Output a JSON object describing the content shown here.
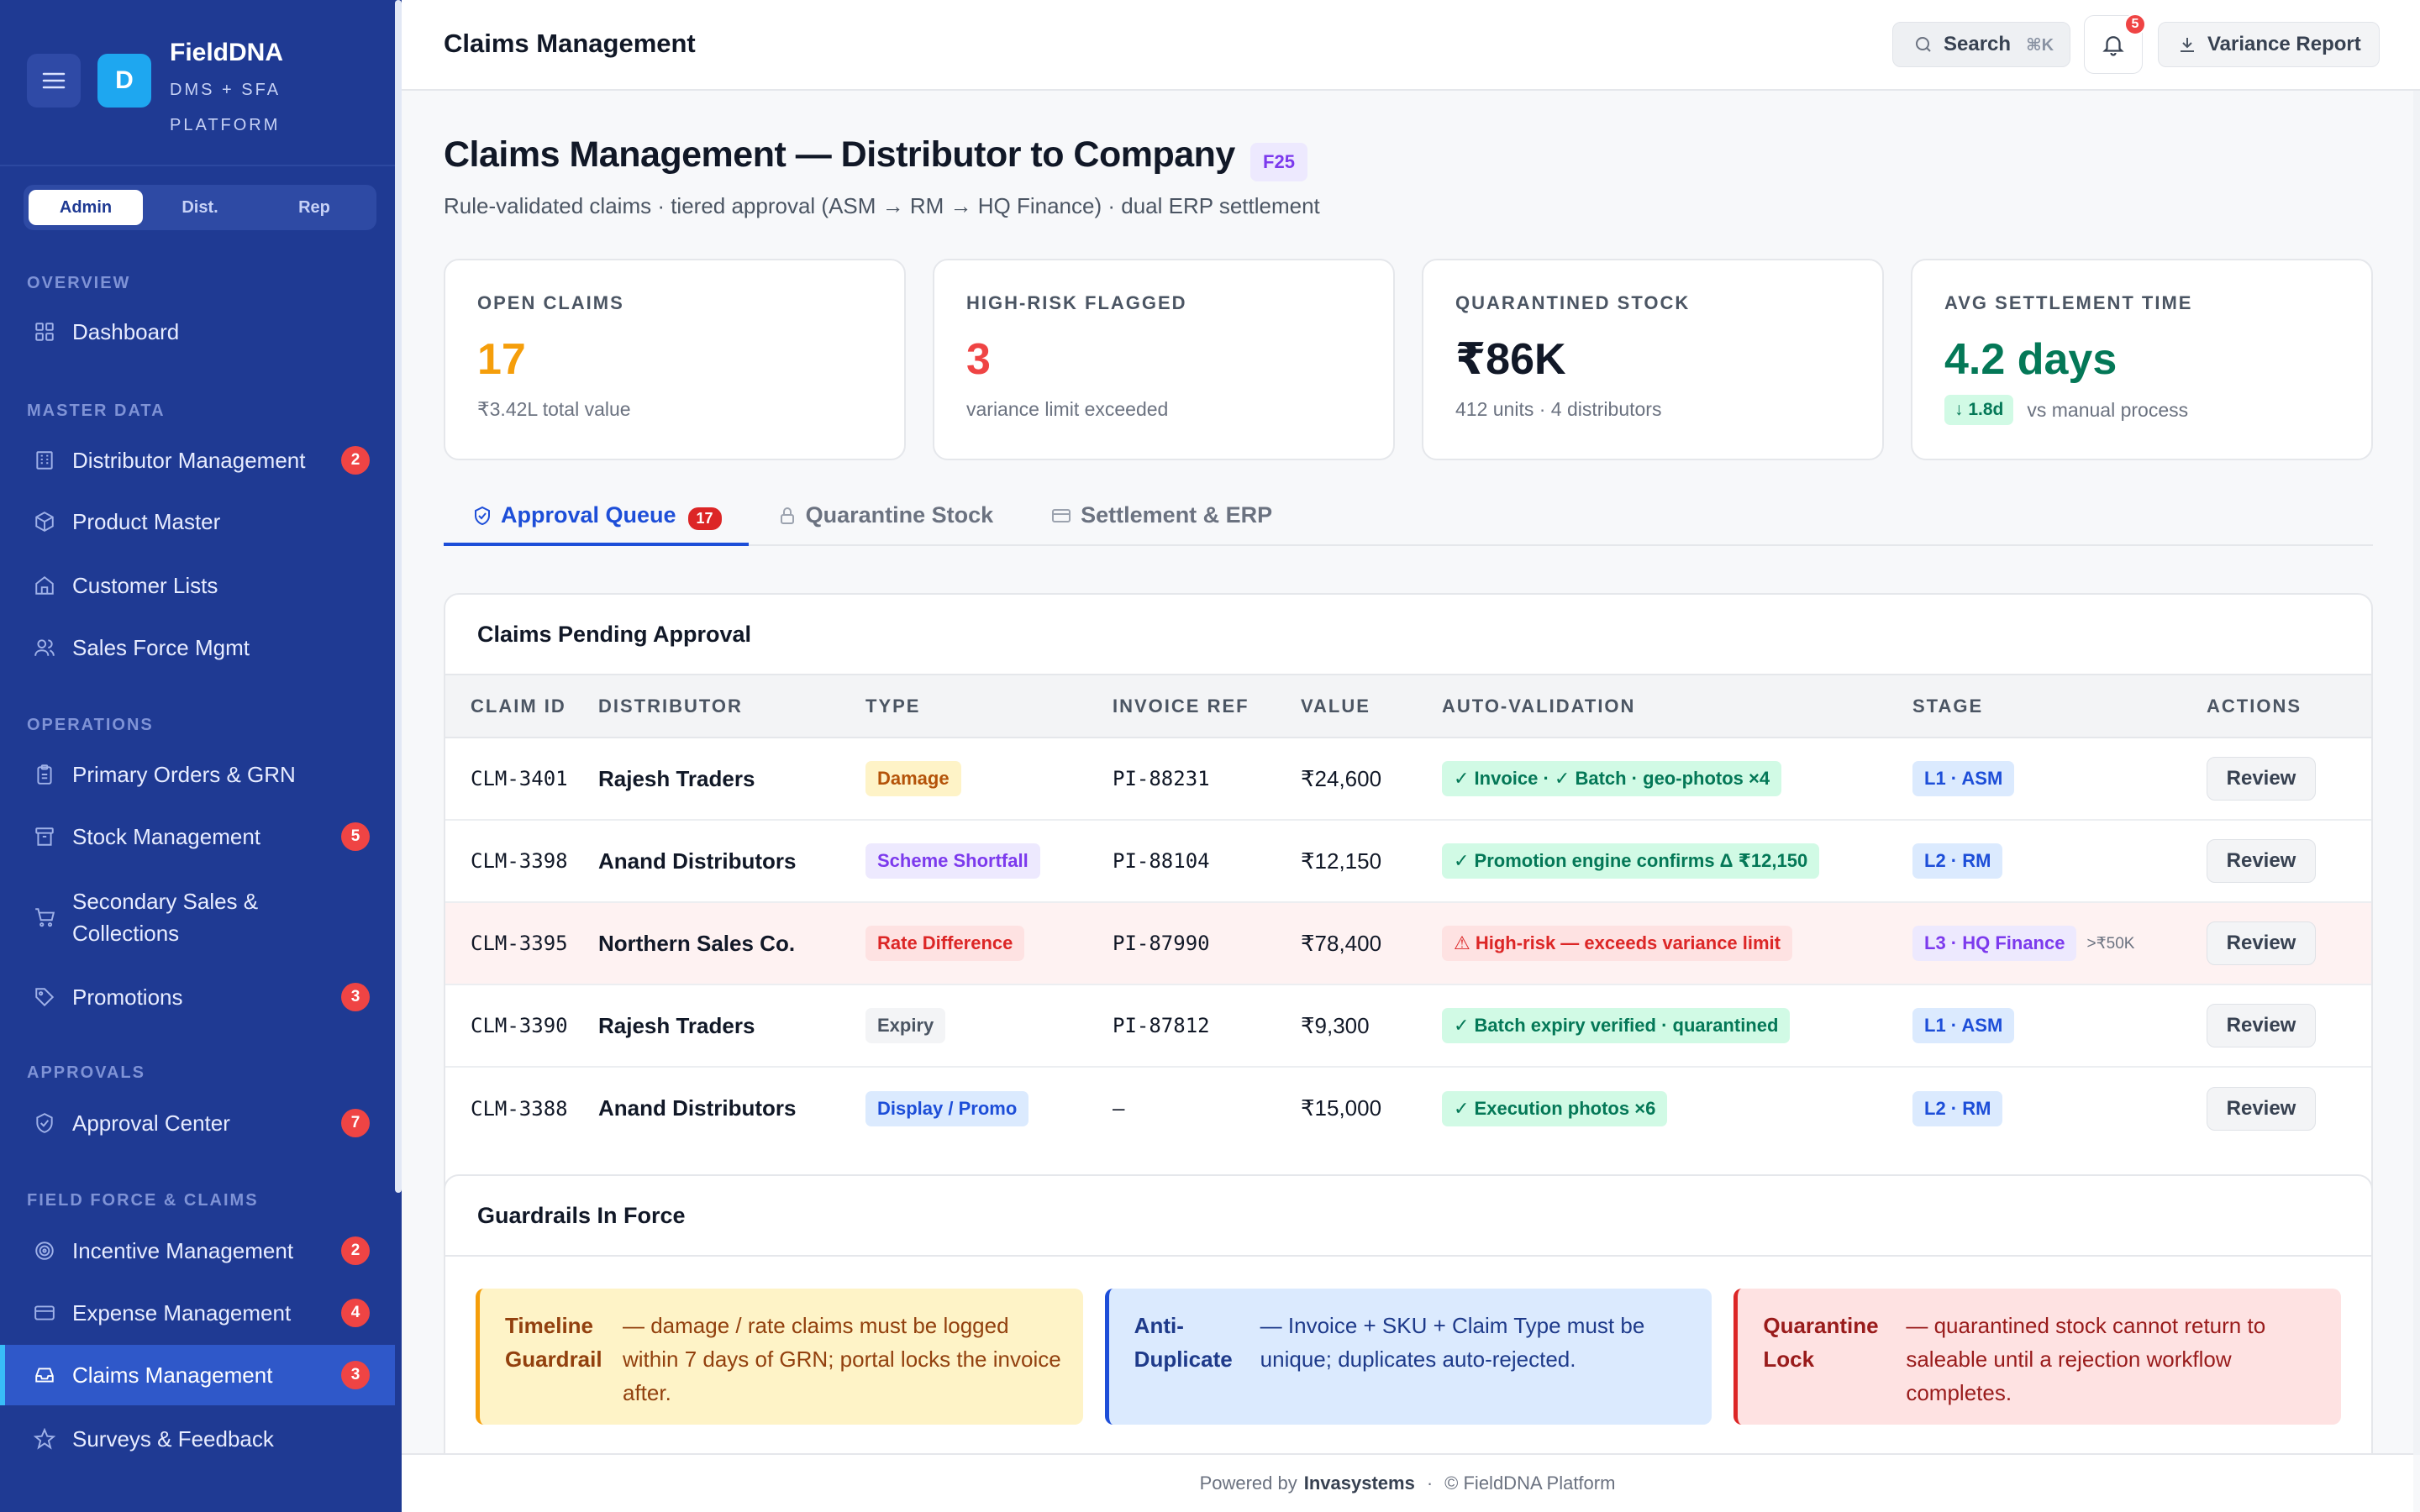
{
  "app": {
    "name": "FieldDNA",
    "subtitle": "DMS + SFA PLATFORM",
    "logo_letter": "D"
  },
  "roles": [
    "Admin",
    "Dist.",
    "Rep"
  ],
  "sidebar": {
    "sections": [
      {
        "title": "OVERVIEW",
        "items": [
          {
            "label": "Dashboard",
            "icon": "grid-icon"
          }
        ]
      },
      {
        "title": "MASTER DATA",
        "items": [
          {
            "label": "Distributor Management",
            "icon": "building-icon",
            "badge": "2"
          },
          {
            "label": "Product Master",
            "icon": "box-icon"
          },
          {
            "label": "Customer Lists",
            "icon": "store-icon"
          },
          {
            "label": "Sales Force Mgmt",
            "icon": "users-icon"
          }
        ]
      },
      {
        "title": "OPERATIONS",
        "items": [
          {
            "label": "Primary Orders & GRN",
            "icon": "clipboard-icon"
          },
          {
            "label": "Stock Management",
            "icon": "archive-icon",
            "badge": "5"
          },
          {
            "label": "Secondary Sales & Collections",
            "icon": "cart-icon"
          },
          {
            "label": "Promotions",
            "icon": "tag-icon",
            "badge": "3"
          }
        ]
      },
      {
        "title": "APPROVALS",
        "items": [
          {
            "label": "Approval Center",
            "icon": "shield-check-icon",
            "badge": "7"
          }
        ]
      },
      {
        "title": "FIELD FORCE & CLAIMS",
        "items": [
          {
            "label": "Incentive Management",
            "icon": "target-icon",
            "badge": "2"
          },
          {
            "label": "Expense Management",
            "icon": "credit-card-icon",
            "badge": "4"
          },
          {
            "label": "Claims Management",
            "icon": "inbox-icon",
            "badge": "3"
          },
          {
            "label": "Surveys & Feedback",
            "icon": "star-icon"
          }
        ]
      }
    ]
  },
  "topbar": {
    "title": "Claims Management",
    "search_label": "Search",
    "search_kbd": "⌘K",
    "notif_count": "5",
    "variance_label": "Variance Report"
  },
  "page": {
    "title": "Claims Management — Distributor to Company",
    "badge": "F25",
    "subtitle": "Rule-validated claims · tiered approval (ASM → RM → HQ Finance) · dual ERP settlement"
  },
  "kpis": [
    {
      "label": "OPEN CLAIMS",
      "value": "17",
      "sub": "₹3.42L total value",
      "color": "#f59e0b"
    },
    {
      "label": "HIGH-RISK FLAGGED",
      "value": "3",
      "sub": "variance limit exceeded",
      "color": "#ef4444"
    },
    {
      "label": "QUARANTINED STOCK",
      "value": "₹86K",
      "sub": "412 units · 4 distributors",
      "color": "#111827"
    },
    {
      "label": "AVG SETTLEMENT TIME",
      "value": "4.2 days",
      "chip": "↓ 1.8d",
      "sub": "vs manual process",
      "color": "#047857"
    }
  ],
  "tabs": [
    {
      "label": "Approval Queue",
      "count": "17"
    },
    {
      "label": "Quarantine Stock"
    },
    {
      "label": "Settlement & ERP"
    }
  ],
  "claims": {
    "title": "Claims Pending Approval",
    "headers": [
      "CLAIM ID",
      "DISTRIBUTOR",
      "TYPE",
      "INVOICE REF",
      "VALUE",
      "AUTO-VALIDATION",
      "STAGE",
      "ACTIONS"
    ],
    "rows": [
      {
        "id": "CLM-3401",
        "distributor": "Rajesh Traders",
        "type": "Damage",
        "invoice": "PI-88231",
        "value": "₹24,600",
        "validation": "✓ Invoice · ✓ Batch · geo-photos ×4",
        "stage": "L1 · ASM",
        "stage_note": "",
        "action": "Review"
      },
      {
        "id": "CLM-3398",
        "distributor": "Anand Distributors",
        "type": "Scheme Shortfall",
        "invoice": "PI-88104",
        "value": "₹12,150",
        "validation": "✓ Promotion engine confirms Δ ₹12,150",
        "stage": "L2 · RM",
        "stage_note": "",
        "action": "Review"
      },
      {
        "id": "CLM-3395",
        "distributor": "Northern Sales Co.",
        "type": "Rate Difference",
        "invoice": "PI-87990",
        "value": "₹78,400",
        "validation": "⚠ High-risk — exceeds variance limit",
        "stage": "L3 · HQ Finance",
        "stage_note": ">₹50K",
        "action": "Review"
      },
      {
        "id": "CLM-3390",
        "distributor": "Rajesh Traders",
        "type": "Expiry",
        "invoice": "PI-87812",
        "value": "₹9,300",
        "validation": "✓ Batch expiry verified · quarantined",
        "stage": "L1 · ASM",
        "stage_note": "",
        "action": "Review"
      },
      {
        "id": "CLM-3388",
        "distributor": "Anand Distributors",
        "type": "Display / Promo",
        "invoice": "—",
        "value": "₹15,000",
        "validation": "✓ Execution photos ×6",
        "stage": "L2 · RM",
        "stage_note": "",
        "action": "Review"
      }
    ]
  },
  "guardrails": {
    "title": "Guardrails In Force",
    "items": [
      {
        "title": "Timeline Guardrail",
        "text": "— damage / rate claims must be logged within 7 days of GRN; portal locks the invoice after."
      },
      {
        "title": "Anti-Duplicate",
        "text": "— Invoice + SKU + Claim Type must be unique; duplicates auto-rejected."
      },
      {
        "title": "Quarantine Lock",
        "text": "— quarantined stock cannot return to saleable until a rejection workflow completes."
      }
    ]
  },
  "footer": {
    "powered": "Powered by",
    "brand": "Invasystems",
    "copyright": "© FieldDNA Platform"
  }
}
